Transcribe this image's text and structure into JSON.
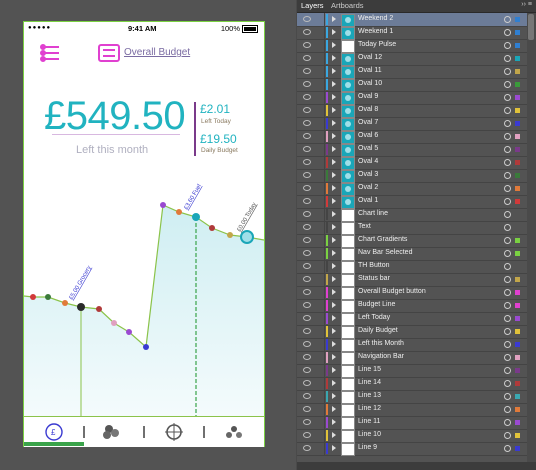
{
  "phone": {
    "status": {
      "time": "9:41 AM",
      "battery": "100%"
    },
    "overall_budget_label": "Overall Budget",
    "amount": "£549.50",
    "left_this_month": "Left this month",
    "left_today_amount": "£2.01",
    "left_today_label": "Left Today",
    "daily_budget_amount": "£19.50",
    "daily_budget_label": "Daily Budget",
    "chart_labels": [
      "£5.00 Grocery",
      "£3.60 Fuel",
      "£0.00 Today"
    ]
  },
  "layers_panel": {
    "tabs": [
      "Layers",
      "Artboards"
    ],
    "rows": [
      {
        "name": "Weekend 2",
        "color": "#3aa7e0",
        "thumb": "teal",
        "sq": "#2f7fd1",
        "selected": true
      },
      {
        "name": "Weekend 1",
        "color": "#3aa7e0",
        "thumb": "teal",
        "sq": "#2f7fd1"
      },
      {
        "name": "Today Pulse",
        "color": "#3aa7e0",
        "thumb": "white",
        "sq": "#2f7fd1"
      },
      {
        "name": "Oval 12",
        "color": "#3aa7e0",
        "thumb": "teal",
        "sq": "#1aa6b8"
      },
      {
        "name": "Oval 11",
        "color": "#3aa7e0",
        "thumb": "teal",
        "sq": "#c2a64a"
      },
      {
        "name": "Oval 10",
        "color": "#3aa7e0",
        "thumb": "teal",
        "sq": "#3a9a3a"
      },
      {
        "name": "Oval 9",
        "color": "#9a4ad1",
        "thumb": "teal",
        "sq": "#9a4ad1"
      },
      {
        "name": "Oval 8",
        "color": "#e0c23a",
        "thumb": "teal",
        "sq": "#e0c23a"
      },
      {
        "name": "Oval 7",
        "color": "#3a3ad1",
        "thumb": "teal",
        "sq": "#3a3ad1"
      },
      {
        "name": "Oval 6",
        "color": "#e0a0c0",
        "thumb": "teal",
        "sq": "#e0a0c0"
      },
      {
        "name": "Oval 5",
        "color": "#7a3a8a",
        "thumb": "teal",
        "sq": "#7a3a8a"
      },
      {
        "name": "Oval 4",
        "color": "#b03a3a",
        "thumb": "teal",
        "sq": "#b03a3a"
      },
      {
        "name": "Oval 3",
        "color": "#3a7a3a",
        "thumb": "teal",
        "sq": "#3a7a3a"
      },
      {
        "name": "Oval 2",
        "color": "#e07a3a",
        "thumb": "teal",
        "sq": "#e07a3a"
      },
      {
        "name": "Oval 1",
        "color": "#d13a3a",
        "thumb": "teal",
        "sq": "#d13a3a"
      },
      {
        "name": "Chart line",
        "color": "#444444",
        "thumb": "white",
        "sq": ""
      },
      {
        "name": "Text",
        "color": "#444444",
        "thumb": "white",
        "sq": ""
      },
      {
        "name": "Chart Gradients",
        "color": "#7ad142",
        "thumb": "white",
        "sq": "#7ad142"
      },
      {
        "name": "Nav Bar Selected",
        "color": "#7ad142",
        "thumb": "white",
        "sq": "#7ad142"
      },
      {
        "name": "TH Button",
        "color": "#444444",
        "thumb": "white",
        "sq": ""
      },
      {
        "name": "Status bar",
        "color": "#c2a64a",
        "thumb": "white",
        "sq": "#c2a64a"
      },
      {
        "name": "Overall Budget button",
        "color": "#e040d0",
        "thumb": "white",
        "sq": "#e040d0"
      },
      {
        "name": "Budget Line",
        "color": "#e040d0",
        "thumb": "white",
        "sq": "#e040d0"
      },
      {
        "name": "Left Today",
        "color": "#9a4ad1",
        "thumb": "white",
        "sq": "#9a4ad1"
      },
      {
        "name": "Daily Budget",
        "color": "#e0c23a",
        "thumb": "white",
        "sq": "#e0c23a"
      },
      {
        "name": "Left this Month",
        "color": "#3a3ad1",
        "thumb": "white",
        "sq": "#3a3ad1"
      },
      {
        "name": "Navigation Bar",
        "color": "#e0a0c0",
        "thumb": "white",
        "sq": "#e0a0c0"
      },
      {
        "name": "Line 15",
        "color": "#7a3a8a",
        "thumb": "white",
        "sq": "#7a3a8a"
      },
      {
        "name": "Line 14",
        "color": "#b03a3a",
        "thumb": "white",
        "sq": "#b03a3a"
      },
      {
        "name": "Line 13",
        "color": "#3aa7b0",
        "thumb": "white",
        "sq": "#3aa7b0"
      },
      {
        "name": "Line 12",
        "color": "#e07a3a",
        "thumb": "white",
        "sq": "#e07a3a"
      },
      {
        "name": "Line 11",
        "color": "#9a4ad1",
        "thumb": "white",
        "sq": "#9a4ad1"
      },
      {
        "name": "Line 10",
        "color": "#e0c23a",
        "thumb": "white",
        "sq": "#e0c23a"
      },
      {
        "name": "Line 9",
        "color": "#3a3ad1",
        "thumb": "white",
        "sq": "#3a3ad1"
      }
    ]
  }
}
